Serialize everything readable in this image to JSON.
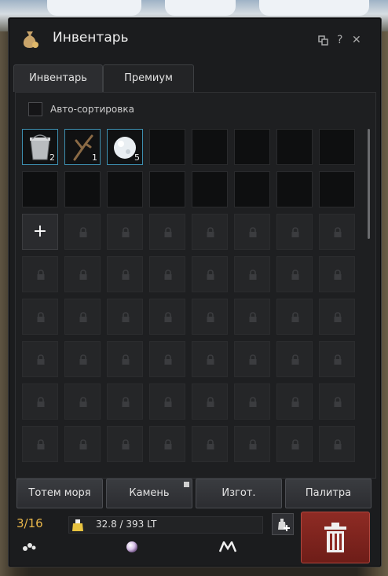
{
  "window": {
    "title": "Инвентарь",
    "title_icon": "money-bag-icon",
    "controls": [
      "popout-icon",
      "help-icon",
      "close-icon"
    ],
    "help_label": "?",
    "close_label": "✕"
  },
  "tabs": [
    {
      "label": "Инвентарь",
      "active": true
    },
    {
      "label": "Премиум",
      "active": false
    }
  ],
  "autosort": {
    "label": "Авто-сортировка",
    "checked": false
  },
  "grid": {
    "columns": 8,
    "items": [
      {
        "name": "bucket",
        "icon": "bucket-icon",
        "qty": "2"
      },
      {
        "name": "branch",
        "icon": "branch-icon",
        "qty": "1"
      },
      {
        "name": "snowball",
        "icon": "snowball-icon",
        "qty": "5"
      }
    ],
    "empty_unlocked_slots": 13,
    "add_slot_label": "+",
    "locked_slot_icon": "lock-icon"
  },
  "buttons": [
    {
      "label": "Тотем моря"
    },
    {
      "label": "Камень",
      "corner_icon": "expand-corner-icon"
    },
    {
      "label": "Изгот."
    },
    {
      "label": "Палитра"
    }
  ],
  "status": {
    "slots": "3/16",
    "weight": "32.8 / 393 LT",
    "weight_icon": "weight-icon",
    "weight_extend_icon": "add-weight-icon",
    "trash_icon": "trash-icon"
  },
  "bottom_icons": [
    "seeds-icon",
    "pearl-icon",
    "m-logo-icon"
  ],
  "colors": {
    "accent": "#e8b64a",
    "filled_slot_border": "#3d8fb0",
    "trash_bg": "#8e2b24"
  }
}
